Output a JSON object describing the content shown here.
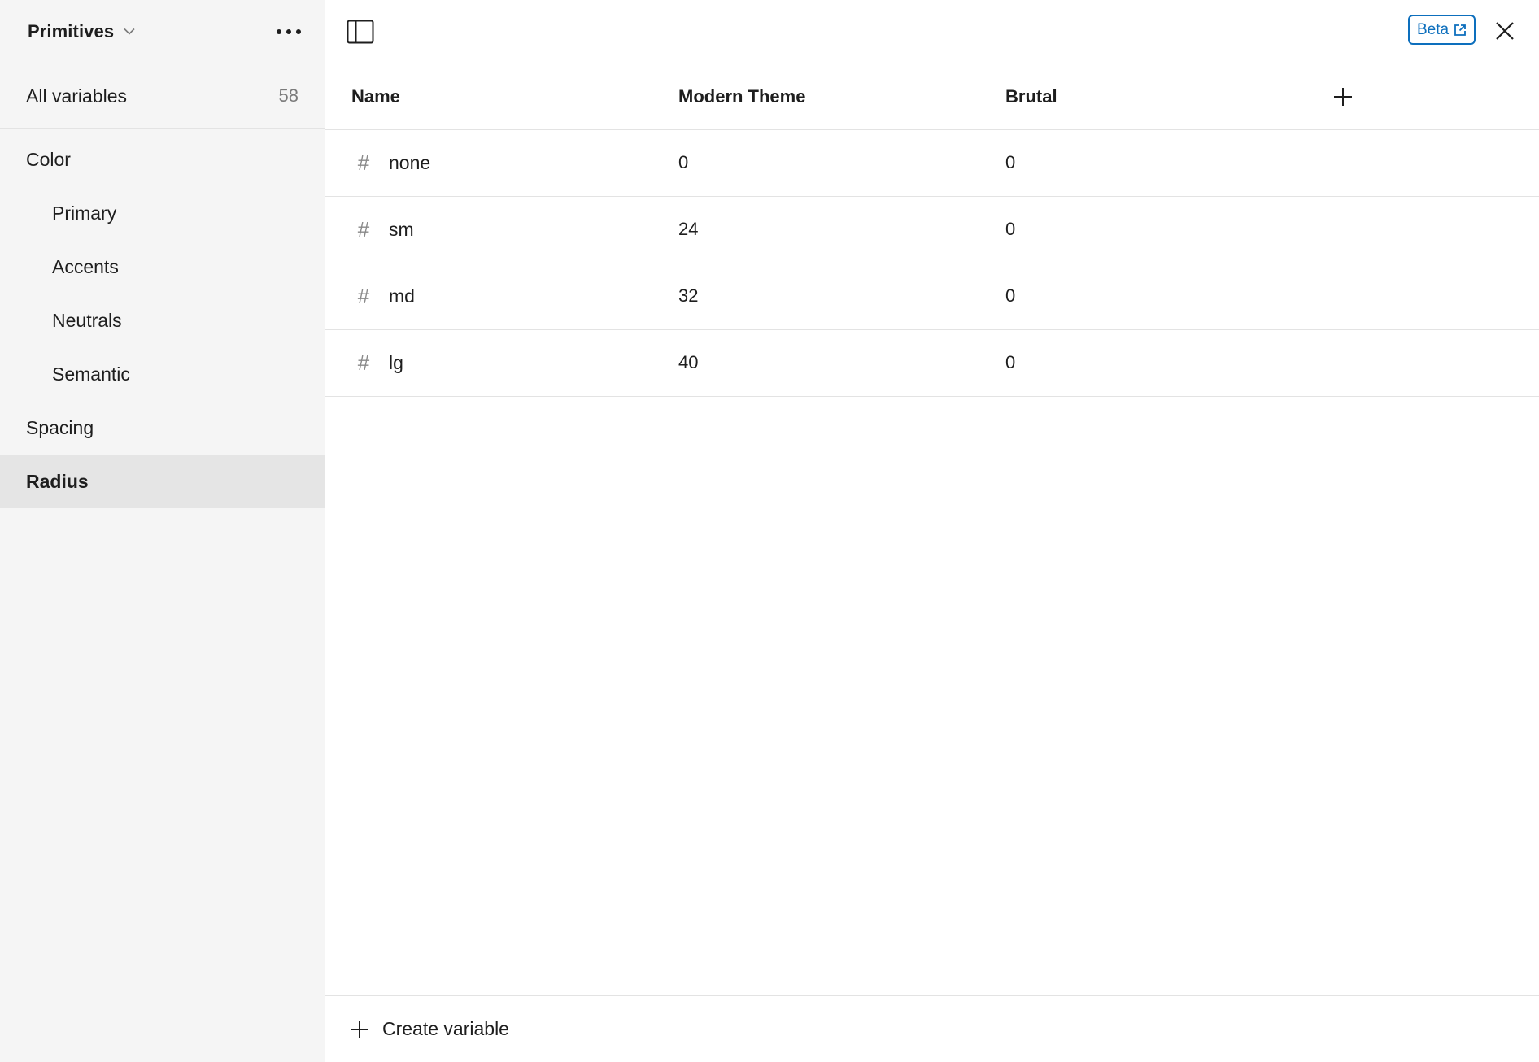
{
  "sidebar": {
    "collection_name": "Primitives",
    "all_variables": {
      "label": "All variables",
      "count": "58"
    },
    "groups": [
      {
        "label": "Color",
        "level": 0,
        "active": false
      },
      {
        "label": "Primary",
        "level": 1,
        "active": false
      },
      {
        "label": "Accents",
        "level": 1,
        "active": false
      },
      {
        "label": "Neutrals",
        "level": 1,
        "active": false
      },
      {
        "label": "Semantic",
        "level": 1,
        "active": false
      },
      {
        "label": "Spacing",
        "level": 0,
        "active": false
      },
      {
        "label": "Radius",
        "level": 0,
        "active": true
      }
    ]
  },
  "topbar": {
    "beta_label": "Beta"
  },
  "table": {
    "columns": [
      "Name",
      "Modern Theme",
      "Brutal"
    ],
    "rows": [
      {
        "name": "none",
        "modern": "0",
        "brutal": "0"
      },
      {
        "name": "sm",
        "modern": "24",
        "brutal": "0"
      },
      {
        "name": "md",
        "modern": "32",
        "brutal": "0"
      },
      {
        "name": "lg",
        "modern": "40",
        "brutal": "0"
      }
    ]
  },
  "footer": {
    "create_label": "Create variable"
  },
  "icons": {
    "variable_type": "hash-icon",
    "collection_dropdown": "chevron-down-icon",
    "more": "more-horizontal-icon",
    "panel": "sidebar-toggle-icon",
    "external": "external-link-icon",
    "close": "close-icon",
    "add": "plus-icon"
  },
  "colors": {
    "accent": "#0d6fbd",
    "sidebar_bg": "#f5f5f5",
    "active_item_bg": "#e5e5e5",
    "border": "#e3e3e3"
  }
}
